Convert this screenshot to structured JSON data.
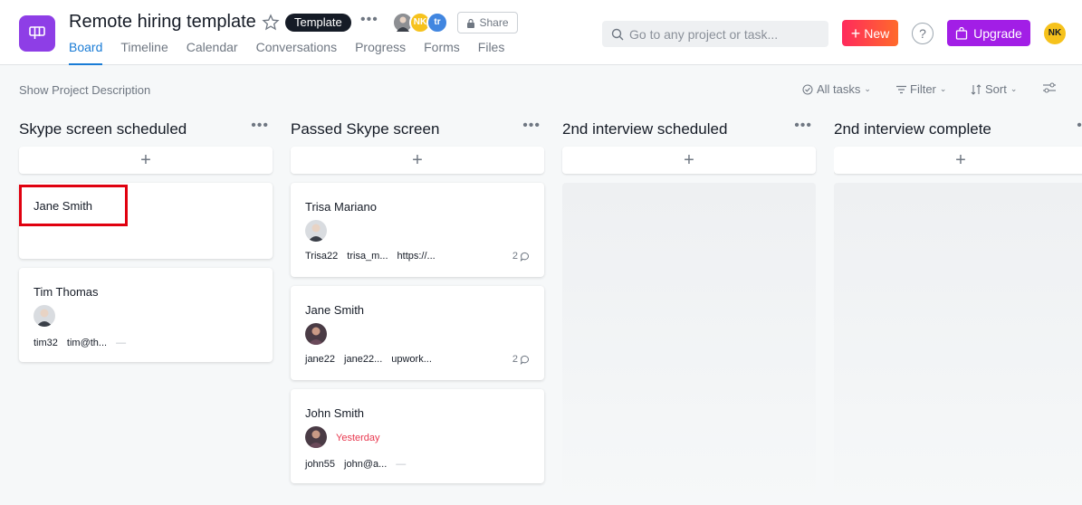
{
  "header": {
    "title": "Remote hiring template",
    "template_badge": "Template",
    "share_label": "Share",
    "tabs": [
      "Board",
      "Timeline",
      "Calendar",
      "Conversations",
      "Progress",
      "Forms",
      "Files"
    ],
    "active_tab": "Board",
    "members": [
      {
        "initials": "",
        "color": "#8d8f93"
      },
      {
        "initials": "NK",
        "color": "#f6c21c"
      },
      {
        "initials": "tr",
        "color": "#4186e0"
      }
    ],
    "search_placeholder": "Go to any project or task...",
    "new_label": "New",
    "help_label": "?",
    "upgrade_label": "Upgrade",
    "user_initials": "NK",
    "brand_purple": "#8e3ee6",
    "accent_blue": "#1a7cd6"
  },
  "toolbar": {
    "show_description": "Show Project Description",
    "all_tasks": "All tasks",
    "filter": "Filter",
    "sort": "Sort"
  },
  "columns": [
    {
      "title": "Skype screen scheduled",
      "cards": [
        {
          "name": "Jane Smith"
        },
        {
          "name": "Tim Thomas",
          "meta": [
            "tim32",
            "tim@th..."
          ],
          "empty_field": "—"
        }
      ]
    },
    {
      "title": "Passed Skype screen",
      "cards": [
        {
          "name": "Trisa Mariano",
          "meta": [
            "Trisa22",
            "trisa_m...",
            "https://..."
          ],
          "comments": "2"
        },
        {
          "name": "Jane Smith",
          "meta": [
            "jane22",
            "jane22...",
            "upwork..."
          ],
          "comments": "2"
        },
        {
          "name": "John Smith",
          "due": "Yesterday",
          "meta": [
            "john55",
            "john@a..."
          ],
          "empty_field": "—"
        }
      ]
    },
    {
      "title": "2nd interview scheduled",
      "cards": []
    },
    {
      "title": "2nd interview complete",
      "cards": []
    }
  ]
}
